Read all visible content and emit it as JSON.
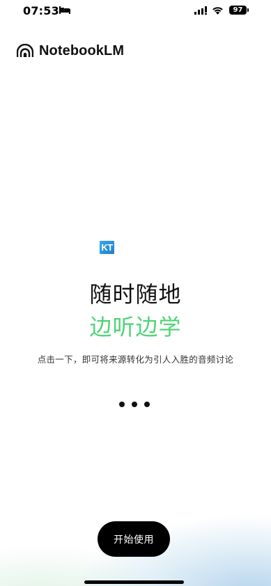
{
  "status_bar": {
    "time": "07:53",
    "battery": "97",
    "icons": [
      "bed-icon",
      "signal-icon",
      "wifi-icon",
      "battery-icon"
    ]
  },
  "header": {
    "logo_icon": "notebooklm-logo-icon",
    "title": "NotebookLM"
  },
  "main": {
    "badge": "KT",
    "headline": "随时随地",
    "subheadline": "边听边学",
    "description": "点击一下，即可将来源转化为引人入胜的音频讨论",
    "pager_dots": 3
  },
  "actions": {
    "start_label": "开始使用"
  },
  "colors": {
    "accent_green": "#4fd477",
    "button_bg": "#000000",
    "badge_blue": "#2a93dd"
  }
}
